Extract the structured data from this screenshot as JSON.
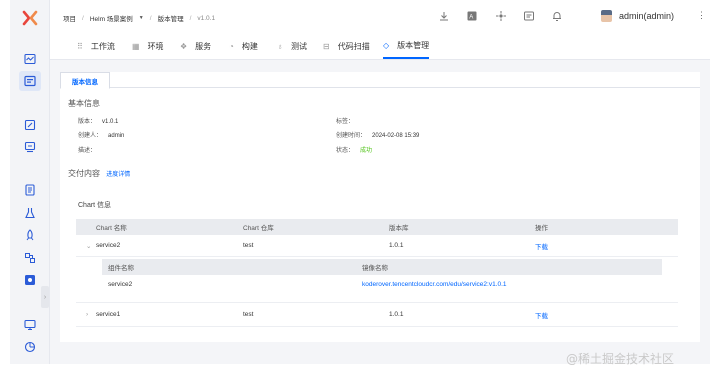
{
  "breadcrumb": {
    "projects": "项目",
    "project": "Helm 场景案例",
    "section": "版本管理",
    "current": "v1.0.1"
  },
  "user": {
    "name": "admin(admin)"
  },
  "tabs": [
    {
      "label": "工作流",
      "icon": "workflow-icon"
    },
    {
      "label": "环境",
      "icon": "environment-icon"
    },
    {
      "label": "服务",
      "icon": "service-icon"
    },
    {
      "label": "构建",
      "icon": "build-icon"
    },
    {
      "label": "测试",
      "icon": "test-icon"
    },
    {
      "label": "代码扫描",
      "icon": "code-scan-icon"
    },
    {
      "label": "版本管理",
      "icon": "version-icon",
      "active": true
    }
  ],
  "subtab": "版本信息",
  "basic": {
    "title": "基本信息",
    "version_label": "版本：",
    "version": "v1.0.1",
    "creator_label": "创建人：",
    "creator": "admin",
    "desc_label": "描述：",
    "desc": "",
    "tag_label": "标签：",
    "tag": "",
    "created_label": "创建时间：",
    "created": "2024-02-08 15:39",
    "status_label": "状态：",
    "status": "成功",
    "status_color": "#52c41a"
  },
  "delivery": {
    "title": "交付内容",
    "progress_link": "进度详情",
    "chart_title": "Chart 信息",
    "columns": [
      "Chart 名称",
      "Chart 仓库",
      "版本库",
      "操作"
    ],
    "rows": [
      {
        "name": "service2",
        "repo": "test",
        "version": "1.0.1",
        "action": "下载",
        "toggle": "⌄"
      },
      {
        "name": "service1",
        "repo": "test",
        "version": "1.0.1",
        "action": "下载",
        "toggle": "›"
      }
    ],
    "nested_columns": [
      "组件名称",
      "镜像名称"
    ],
    "nested_rows": [
      {
        "component": "service2",
        "image": "koderover.tencentcloudcr.com/edu/service2:v1.0.1"
      }
    ]
  },
  "watermark": "@稀土掘金技术社区",
  "colors": {
    "accent": "#0066ff",
    "brand_red": "#e8453c",
    "sidebar": "#f3f4f7"
  }
}
